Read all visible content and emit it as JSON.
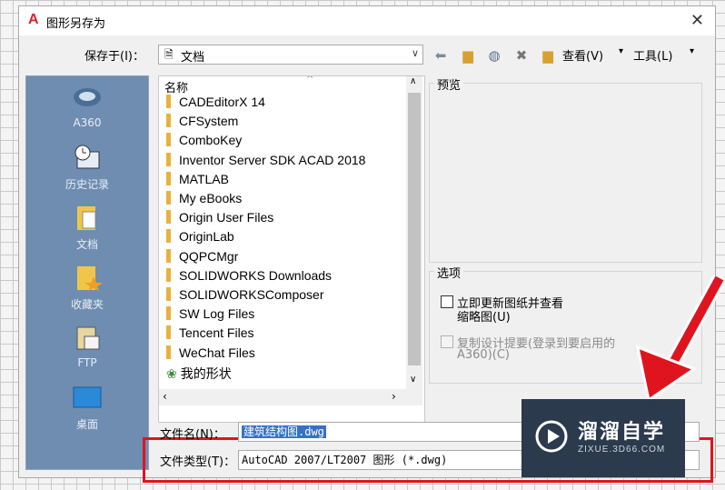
{
  "window": {
    "title": "图形另存为",
    "close_glyph": "✕"
  },
  "save_in": {
    "label": "保存于(I)：",
    "value": "文档"
  },
  "toolbar": {
    "view_label": "查看(V)",
    "tools_label": "工具(L)"
  },
  "places": [
    {
      "label": "A360",
      "icon": "a360-icon"
    },
    {
      "label": "历史记录",
      "icon": "history-icon"
    },
    {
      "label": "文档",
      "icon": "documents-icon"
    },
    {
      "label": "收藏夹",
      "icon": "favorites-icon"
    },
    {
      "label": "FTP",
      "icon": "ftp-icon"
    },
    {
      "label": "桌面",
      "icon": "desktop-icon"
    }
  ],
  "file_list": {
    "column_header": "名称",
    "items": [
      "CADEditorX 14",
      "CFSystem",
      "ComboKey",
      "Inventor Server SDK ACAD 2018",
      "MATLAB",
      "My eBooks",
      "Origin User Files",
      "OriginLab",
      "QQPCMgr",
      "SOLIDWORKS Downloads",
      "SOLIDWORKSComposer",
      "SW Log Files",
      "Tencent Files",
      "WeChat Files",
      "我的形状"
    ]
  },
  "preview": {
    "title": "预览"
  },
  "options": {
    "title": "选项",
    "update_thumbnail": "立即更新图纸并查看",
    "update_thumbnail_2": "缩略图(U)",
    "copy_design": "复制设计提要(登录到要启用的",
    "copy_design_2": "A360)(C)"
  },
  "filename": {
    "label": "文件名(N)：",
    "value": "建筑结构图.dwg"
  },
  "filetype": {
    "label": "文件类型(T)：",
    "value": "AutoCAD 2007/LT2007 图形 (*.dwg)"
  },
  "watermark": {
    "brand": "溜溜自学",
    "url": "ZIXUE.3D66.COM"
  },
  "colors": {
    "highlight": "#e0141e",
    "places_bg": "#6f8db0",
    "selection": "#3870c8"
  }
}
